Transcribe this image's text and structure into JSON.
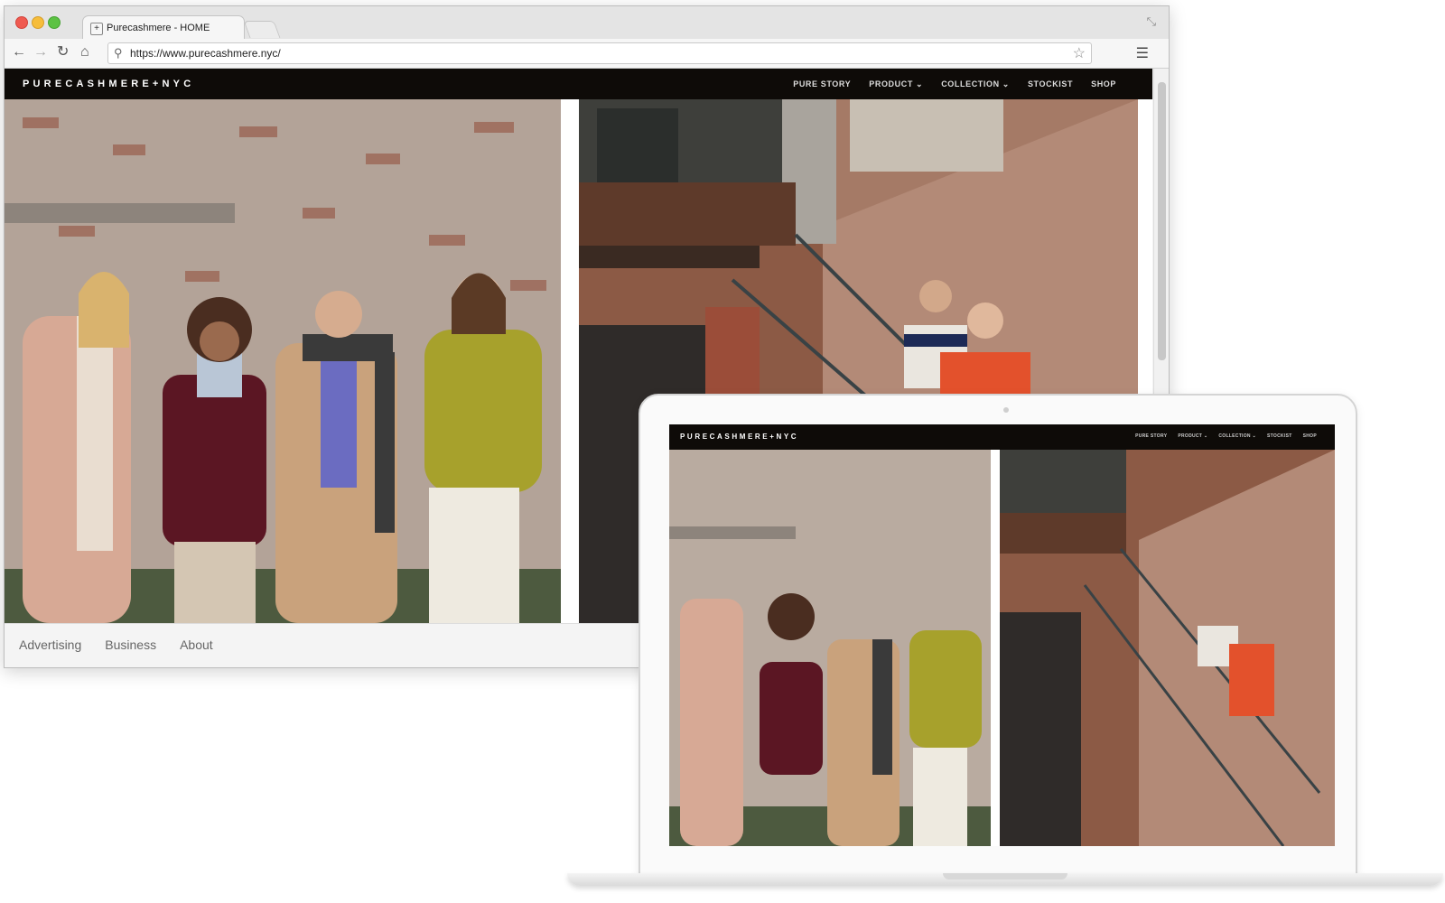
{
  "browser": {
    "tab_title": "Purecashmere - HOME",
    "url": "https://www.purecashmere.nyc/"
  },
  "site": {
    "logo": "PURECASHMERE+NYC",
    "nav": [
      {
        "label": "PURE STORY"
      },
      {
        "label": "PRODUCT ⌄"
      },
      {
        "label": "COLLECTION ⌄"
      },
      {
        "label": "STOCKIST"
      },
      {
        "label": "SHOP"
      }
    ]
  },
  "footer": {
    "links": [
      "Advertising",
      "Business",
      "About"
    ]
  },
  "colors": {
    "nav_bg": "#0e0b08",
    "wall": "#b7a79a",
    "brick": "#9a4a36"
  },
  "icons": [
    "back-arrow-icon",
    "forward-arrow-icon",
    "reload-icon",
    "home-icon",
    "search-icon",
    "bookmark-star-icon",
    "menu-icon"
  ]
}
